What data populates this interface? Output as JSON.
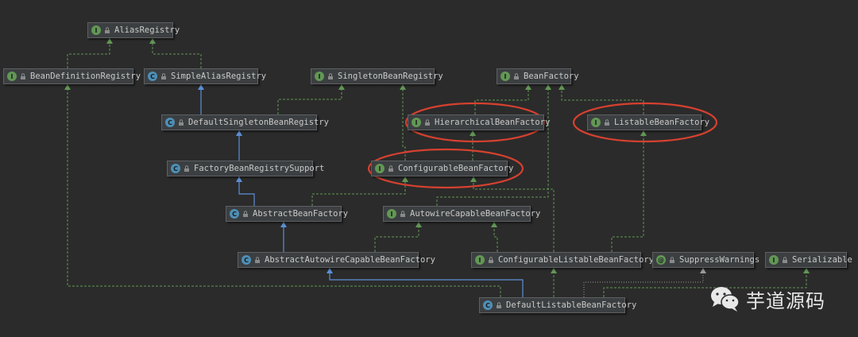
{
  "nodes": [
    {
      "id": "alias",
      "label": "AliasRegistry",
      "kind": "interface"
    },
    {
      "id": "bdr",
      "label": "BeanDefinitionRegistry",
      "kind": "interface"
    },
    {
      "id": "sar",
      "label": "SimpleAliasRegistry",
      "kind": "class"
    },
    {
      "id": "sbr",
      "label": "SingletonBeanRegistry",
      "kind": "interface"
    },
    {
      "id": "bf",
      "label": "BeanFactory",
      "kind": "interface"
    },
    {
      "id": "dsbr",
      "label": "DefaultSingletonBeanRegistry",
      "kind": "class"
    },
    {
      "id": "hbf",
      "label": "HierarchicalBeanFactory",
      "kind": "interface"
    },
    {
      "id": "lbf",
      "label": "ListableBeanFactory",
      "kind": "interface"
    },
    {
      "id": "fbrs",
      "label": "FactoryBeanRegistrySupport",
      "kind": "abstract"
    },
    {
      "id": "cbf",
      "label": "ConfigurableBeanFactory",
      "kind": "interface"
    },
    {
      "id": "abf",
      "label": "AbstractBeanFactory",
      "kind": "abstract"
    },
    {
      "id": "acbf",
      "label": "AutowireCapableBeanFactory",
      "kind": "interface"
    },
    {
      "id": "aacbf",
      "label": "AbstractAutowireCapableBeanFactory",
      "kind": "abstract"
    },
    {
      "id": "clbf",
      "label": "ConfigurableListableBeanFactory",
      "kind": "interface"
    },
    {
      "id": "sw",
      "label": "SuppressWarnings",
      "kind": "annotation"
    },
    {
      "id": "ser",
      "label": "Serializable",
      "kind": "interface"
    },
    {
      "id": "dlbf",
      "label": "DefaultListableBeanFactory",
      "kind": "class"
    }
  ],
  "highlighted": [
    "hbf",
    "lbf",
    "cbf"
  ],
  "colors": {
    "background": "#2b2b2b",
    "implements_edge": "#629755",
    "extends_edge": "#5c8fd6",
    "highlight_ellipse": "#d6412f",
    "node_fill": "#3c3f41",
    "node_text": "#c9c9c9"
  },
  "icons": {
    "interface": "I",
    "class": "C",
    "abstract": "C",
    "annotation": "@"
  },
  "watermark": {
    "icon": "wechat-icon",
    "text": "芋道源码"
  }
}
